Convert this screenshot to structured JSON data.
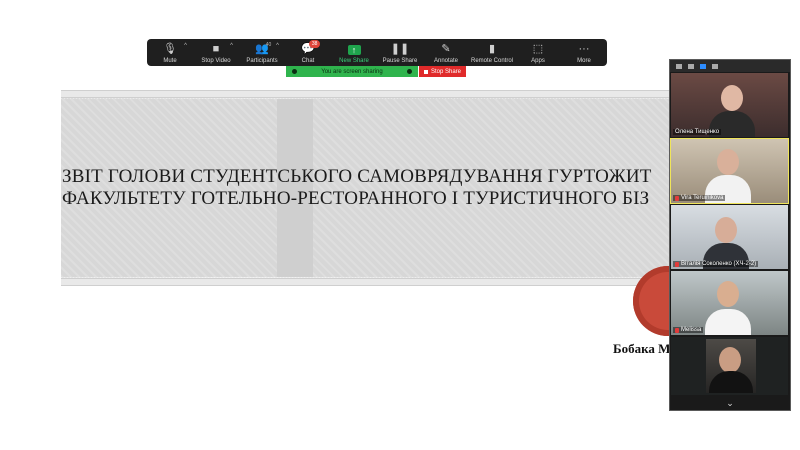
{
  "toolbar": {
    "items": [
      {
        "label": "Mute",
        "icon": "microphone-icon"
      },
      {
        "label": "Stop Video",
        "icon": "video-camera-icon"
      },
      {
        "label": "Participants",
        "icon": "participants-icon",
        "count": "40"
      },
      {
        "label": "Chat",
        "icon": "chat-icon",
        "badge": "38"
      },
      {
        "label": "New Share",
        "icon": "share-screen-icon"
      },
      {
        "label": "Pause Share",
        "icon": "pause-icon"
      },
      {
        "label": "Annotate",
        "icon": "pencil-icon"
      },
      {
        "label": "Remote Control",
        "icon": "mouse-icon"
      },
      {
        "label": "Apps",
        "icon": "apps-icon"
      },
      {
        "label": "More",
        "icon": "more-icon"
      }
    ]
  },
  "share_status": {
    "text": "You are screen sharing",
    "stop_label": "Stop Share"
  },
  "slide": {
    "title_line1": "ЗВІТ ГОЛОВИ СТУДЕНТСЬКОГО САМОВРЯДУВАННЯ ГУРТОЖИТ",
    "title_line2": "ФАКУЛЬТЕТУ ГОТЕЛЬНО-РЕСТОРАННОГО І ТУРИСТИЧНОГО БІЗ",
    "author": "Бобака М"
  },
  "participants": [
    {
      "name": "Олена Тищенко",
      "muted": false
    },
    {
      "name": "Vira Teruinikova",
      "muted": true
    },
    {
      "name": "Віталія Соколенко (ХЧ-2-2)",
      "muted": true
    },
    {
      "name": "Melissa",
      "muted": true
    },
    {
      "name": "",
      "muted": false
    }
  ],
  "colors": {
    "toolbar_bg": "#1f1f1f",
    "share_green": "#2fb44d",
    "stop_red": "#e02a2a",
    "logo_red": "#c94a3a",
    "active_speaker": "#f0e55a"
  }
}
